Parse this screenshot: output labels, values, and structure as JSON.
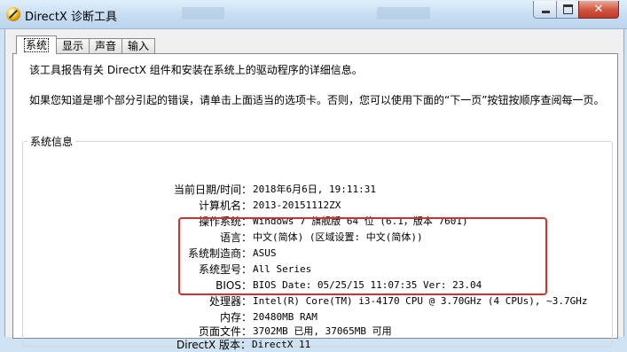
{
  "window": {
    "title": "DirectX 诊断工具",
    "close_glyph": "✕"
  },
  "tabs": [
    {
      "label": "系统"
    },
    {
      "label": "显示"
    },
    {
      "label": "声音"
    },
    {
      "label": "输入"
    }
  ],
  "description": {
    "line1": "该工具报告有关 DirectX 组件和安装在系统上的驱动程序的详细信息。",
    "line2": "如果您知道是哪个部分引起的错误，请单击上面适当的选项卡。否则，您可以使用下面的“下一页”按钮按顺序查阅每一页。"
  },
  "system_info": {
    "title": "系统信息",
    "rows": [
      {
        "label": "当前日期/时间：",
        "value": "2018年6月6日, 19:11:31"
      },
      {
        "label": "计算机名：",
        "value": "2013-20151112ZX"
      },
      {
        "label": "操作系统：",
        "value": "Windows 7 旗舰版 64 位 (6.1，版本 7601)"
      },
      {
        "label": "语言：",
        "value": "中文(简体) (区域设置: 中文(简体))"
      },
      {
        "label": "系统制造商：",
        "value": "ASUS"
      },
      {
        "label": "系统型号：",
        "value": "All Series"
      },
      {
        "label": "BIOS：",
        "value": "BIOS Date: 05/25/15 11:07:35 Ver: 23.04"
      },
      {
        "label": "处理器：",
        "value": "Intel(R) Core(TM) i3-4170 CPU @ 3.70GHz (4 CPUs), ~3.7GHz"
      },
      {
        "label": "内存：",
        "value": "20480MB RAM"
      },
      {
        "label": "页面文件：",
        "value": "3702MB 已用, 37065MB 可用"
      },
      {
        "label": "DirectX 版本：",
        "value": "DirectX 11"
      }
    ]
  },
  "colors": {
    "highlight_box": "#d0312d",
    "titlebar": "#c5dcf2"
  }
}
